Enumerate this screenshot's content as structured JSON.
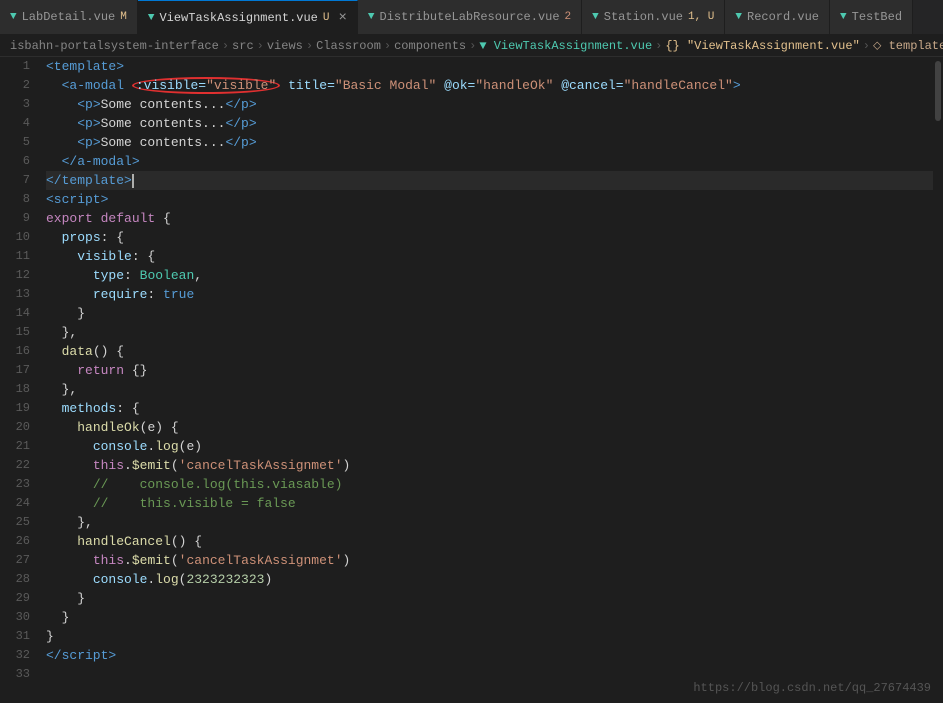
{
  "tabs": [
    {
      "id": "tab1",
      "label": "LabDetail.vue",
      "badge": "M",
      "badge_color": "green",
      "active": false,
      "closable": false
    },
    {
      "id": "tab2",
      "label": "ViewTaskAssignment.vue",
      "badge": "U",
      "badge_color": "yellow",
      "active": true,
      "closable": true
    },
    {
      "id": "tab3",
      "label": "DistributeLabResource.vue",
      "badge": "2",
      "badge_color": "orange",
      "active": false,
      "closable": false
    },
    {
      "id": "tab4",
      "label": "Station.vue",
      "badge": "1, U",
      "badge_color": "yellow",
      "active": false,
      "closable": false
    },
    {
      "id": "tab5",
      "label": "Record.vue",
      "badge": "",
      "badge_color": "",
      "active": false,
      "closable": false
    },
    {
      "id": "tab6",
      "label": "TestBed",
      "badge": "",
      "badge_color": "",
      "active": false,
      "closable": false
    }
  ],
  "breadcrumb": {
    "parts": [
      "isbahn-portalsystem-interface",
      "src",
      "views",
      "Classroom",
      "components",
      "ViewTaskAssignment.vue",
      "{} \"ViewTaskAssignment.vue\"",
      "template"
    ]
  },
  "code": {
    "lines": [
      {
        "num": 1,
        "html": "<span class='t-tag'>&lt;template&gt;</span>"
      },
      {
        "num": 2,
        "html": "  <span class='t-tag'>&lt;a-modal</span> <span class='highlight-circle'><span class='t-attr'>:visible=</span><span class='t-val'>\"visible\"</span></span> <span class='t-attr'>title=</span><span class='t-val'>\"Basic Modal\"</span> <span class='t-attr'>@ok=</span><span class='t-val'>\"handleOk\"</span> <span class='t-attr'>@cancel=</span><span class='t-val'>\"handleCancel\"</span><span class='t-tag'>&gt;</span>"
      },
      {
        "num": 3,
        "html": "    <span class='t-tag'>&lt;p&gt;</span><span class='t-white'>Some contents...</span><span class='t-tag'>&lt;/p&gt;</span>"
      },
      {
        "num": 4,
        "html": "    <span class='t-tag'>&lt;p&gt;</span><span class='t-white'>Some contents...</span><span class='t-tag'>&lt;/p&gt;</span>"
      },
      {
        "num": 5,
        "html": "    <span class='t-tag'>&lt;p&gt;</span><span class='t-white'>Some contents...</span><span class='t-tag'>&lt;/p&gt;</span>"
      },
      {
        "num": 6,
        "html": "  <span class='t-tag'>&lt;/a-modal&gt;</span>"
      },
      {
        "num": 7,
        "html": "<span class='t-tag'>&lt;/template&gt;</span><span class='cursor'></span>",
        "active": true
      },
      {
        "num": 8,
        "html": "<span class='t-tag'>&lt;script&gt;</span>"
      },
      {
        "num": 9,
        "html": "<span class='t-keyword'>export</span> <span class='t-keyword'>default</span> <span class='t-white'>{</span>"
      },
      {
        "num": 10,
        "html": "  <span class='t-prop'>props</span><span class='t-white'>: {</span>"
      },
      {
        "num": 11,
        "html": "    <span class='t-prop'>visible</span><span class='t-white'>: {</span>"
      },
      {
        "num": 12,
        "html": "      <span class='t-prop'>type</span><span class='t-white'>:</span> <span class='t-type'>Boolean</span><span class='t-white'>,</span>"
      },
      {
        "num": 13,
        "html": "      <span class='t-prop'>require</span><span class='t-white'>:</span> <span class='t-bool'>true</span>"
      },
      {
        "num": 14,
        "html": "    <span class='t-white'>}</span>"
      },
      {
        "num": 15,
        "html": "  <span class='t-white'>},</span>"
      },
      {
        "num": 16,
        "html": "  <span class='t-func'>data</span><span class='t-white'>() {</span>"
      },
      {
        "num": 17,
        "html": "    <span class='t-keyword'>return</span> <span class='t-white'>{}</span>"
      },
      {
        "num": 18,
        "html": "  <span class='t-white'>},</span>"
      },
      {
        "num": 19,
        "html": "  <span class='t-prop'>methods</span><span class='t-white'>: {</span>"
      },
      {
        "num": 20,
        "html": "    <span class='t-func'>handleOk</span><span class='t-white'>(e) {</span>"
      },
      {
        "num": 21,
        "html": "      <span class='t-prop'>console</span><span class='t-white'>.</span><span class='t-func'>log</span><span class='t-white'>(e)</span>"
      },
      {
        "num": 22,
        "html": "      <span class='t-keyword'>this</span><span class='t-white'>.</span><span class='t-func'>$emit</span><span class='t-white'>(</span><span class='t-string'>'cancelTaskAssignmet'</span><span class='t-white'>)</span>"
      },
      {
        "num": 23,
        "html": "      <span class='t-comment'>//    console.log(this.viasable)</span>"
      },
      {
        "num": 24,
        "html": "      <span class='t-comment'>//    this.visible = false</span>"
      },
      {
        "num": 25,
        "html": "    <span class='t-white'>},</span>"
      },
      {
        "num": 26,
        "html": "    <span class='t-func'>handleCancel</span><span class='t-white'>() {</span>"
      },
      {
        "num": 27,
        "html": "      <span class='t-keyword'>this</span><span class='t-white'>.</span><span class='t-func'>$emit</span><span class='t-white'>(</span><span class='t-string'>'cancelTaskAssignmet'</span><span class='t-white'>)</span>"
      },
      {
        "num": 28,
        "html": "      <span class='t-prop'>console</span><span class='t-white'>.</span><span class='t-func'>log</span><span class='t-white'>(</span><span class='t-num'>2323232323</span><span class='t-white'>)</span>"
      },
      {
        "num": 29,
        "html": "    <span class='t-white'>}</span>"
      },
      {
        "num": 30,
        "html": "  <span class='t-white'>}</span>"
      },
      {
        "num": 31,
        "html": "<span class='t-white'>}</span>"
      },
      {
        "num": 32,
        "html": "<span class='t-tag'>&lt;/script&gt;</span>"
      },
      {
        "num": 33,
        "html": ""
      }
    ]
  },
  "watermark": "https://blog.csdn.net/qq_27674439"
}
